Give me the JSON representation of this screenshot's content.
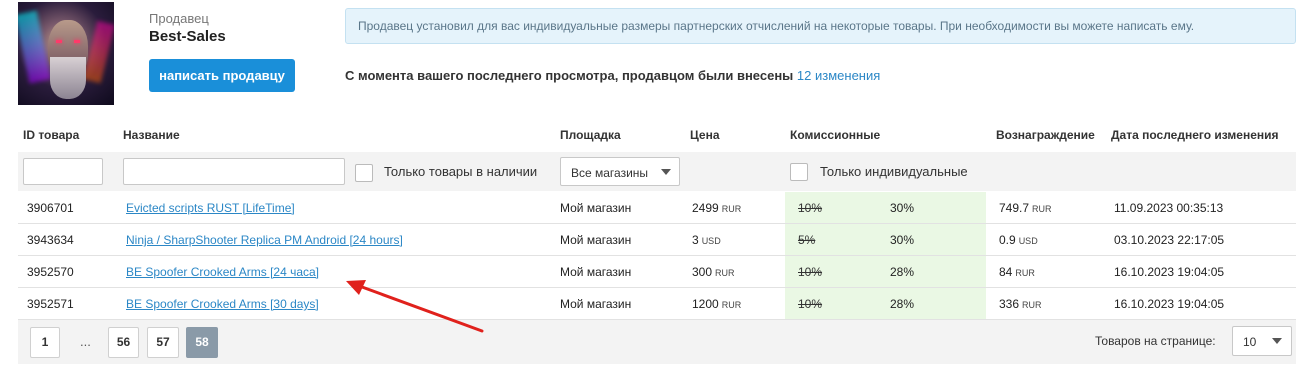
{
  "seller": {
    "label": "Продавец",
    "name": "Best-Sales",
    "write_button": "написать продавцу"
  },
  "info_message": "Продавец установил для вас индивидуальные размеры партнерских отчислений на некоторые товары. При необходимости вы можете написать ему.",
  "changes": {
    "text": "С момента вашего последнего просмотра, продавцом были внесены",
    "link": "12 изменения"
  },
  "table": {
    "headers": {
      "id": "ID товара",
      "name": "Название",
      "platform": "Площадка",
      "price": "Цена",
      "commission": "Комиссионные",
      "reward": "Вознаграждение",
      "date": "Дата последнего изменения"
    },
    "filters": {
      "id_value": "",
      "name_value": "",
      "in_stock_label": "Только товары в наличии",
      "in_stock_checked": false,
      "store_select": "Все магазины",
      "individual_label": "Только индивидуальные",
      "individual_checked": false
    },
    "rows": [
      {
        "id": "3906701",
        "name": "Evicted scripts RUST [LifeTime]",
        "platform": "Мой магазин",
        "price": "2499",
        "price_cur": "RUR",
        "old_commission": "10%",
        "commission": "30%",
        "reward": "749.7",
        "reward_cur": "RUR",
        "date": "11.09.2023 00:35:13"
      },
      {
        "id": "3943634",
        "name": "Ninja / SharpShooter Replica PM Android [24 hours]",
        "platform": "Мой магазин",
        "price": "3",
        "price_cur": "USD",
        "old_commission": "5%",
        "commission": "30%",
        "reward": "0.9",
        "reward_cur": "USD",
        "date": "03.10.2023 22:17:05"
      },
      {
        "id": "3952570",
        "name": "BE Spoofer Crooked Arms [24 часа]",
        "platform": "Мой магазин",
        "price": "300",
        "price_cur": "RUR",
        "old_commission": "10%",
        "commission": "28%",
        "reward": "84",
        "reward_cur": "RUR",
        "date": "16.10.2023 19:04:05"
      },
      {
        "id": "3952571",
        "name": "BE Spoofer Crooked Arms [30 days]",
        "platform": "Мой магазин",
        "price": "1200",
        "price_cur": "RUR",
        "old_commission": "10%",
        "commission": "28%",
        "reward": "336",
        "reward_cur": "RUR",
        "date": "16.10.2023 19:04:05"
      }
    ]
  },
  "pagination": {
    "pages": [
      "1",
      "56",
      "57",
      "58"
    ],
    "ellipsis": "...",
    "current": "58",
    "per_page_label": "Товаров на странице:",
    "per_page_value": "10"
  },
  "colors": {
    "accent": "#1a8fd9",
    "link": "#2b87c6",
    "commission_bg": "#eaf8e4",
    "annotation_arrow": "#e0211c"
  },
  "icons": {
    "dropdown": "caret-down-icon",
    "annotation": "red-arrow-icon"
  }
}
